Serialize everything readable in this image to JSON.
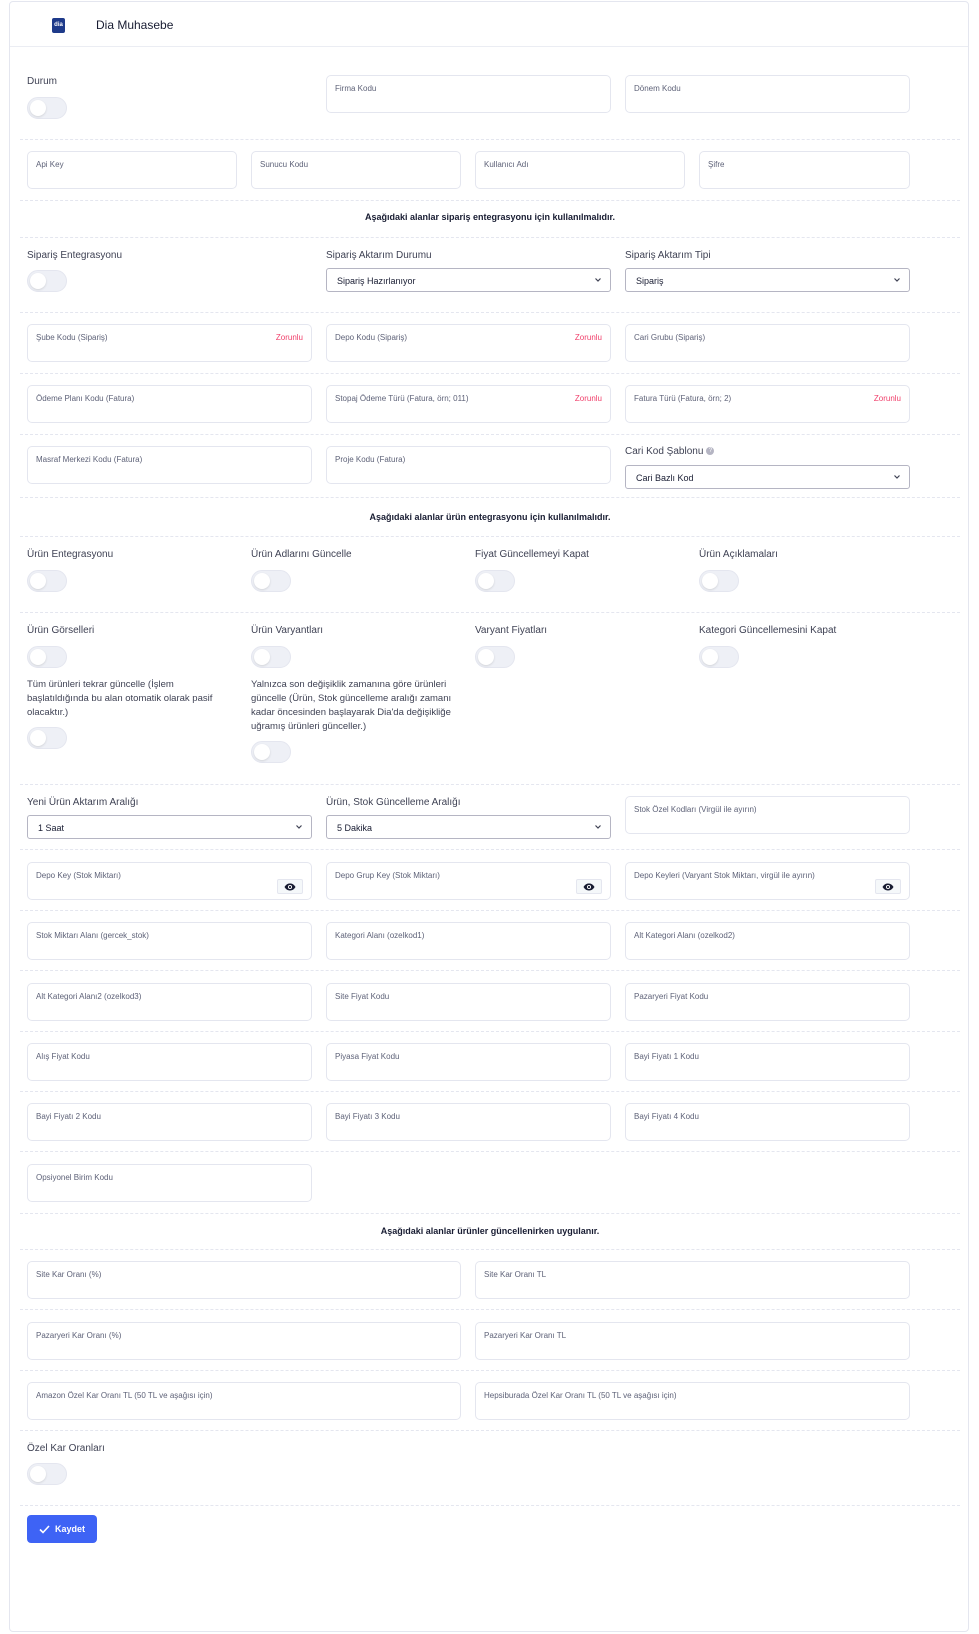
{
  "header": {
    "title": "Dia Muhasebe",
    "logo_text": "dia"
  },
  "general": {
    "durum_label": "Durum",
    "firma_kodu": "Firma Kodu",
    "donem_kodu": "Dönem Kodu",
    "api_key": "Api Key",
    "sunucu_kodu": "Sunucu Kodu",
    "kullanici_adi": "Kullanıcı Adı",
    "sifre": "Şifre"
  },
  "siparis": {
    "section_title": "Aşağıdaki alanlar sipariş entegrasyonu için kullanılmalıdır.",
    "entegrasyon_label": "Sipariş Entegrasyonu",
    "aktarim_durumu_label": "Sipariş Aktarım Durumu",
    "aktarim_durumu_value": "Sipariş Hazırlanıyor",
    "aktarim_tipi_label": "Sipariş Aktarım Tipi",
    "aktarim_tipi_value": "Sipariş",
    "sube_kodu": "Şube Kodu (Sipariş)",
    "depo_kodu": "Depo Kodu (Sipariş)",
    "cari_grubu": "Cari Grubu (Sipariş)",
    "odeme_plani": "Ödeme Planı Kodu (Fatura)",
    "stopaj": "Stopaj Ödeme Türü (Fatura, örn; 011)",
    "fatura_turu": "Fatura Türü (Fatura, örn; 2)",
    "masraf_merkezi": "Masraf Merkezi Kodu (Fatura)",
    "proje_kodu": "Proje Kodu (Fatura)",
    "cari_sablon_label": "Cari Kod Şablonu",
    "cari_sablon_value": "Cari Bazlı Kod",
    "required": "Zorunlu"
  },
  "urun": {
    "section_title": "Aşağıdaki alanlar ürün entegrasyonu için kullanılmalıdır.",
    "toggles": [
      "Ürün Entegrasyonu",
      "Ürün Adlarını Güncelle",
      "Fiyat Güncellemeyi Kapat",
      "Ürün Açıklamaları",
      "Ürün Görselleri",
      "Ürün Varyantları",
      "Varyant Fiyatları",
      "Kategori Güncellemesini Kapat"
    ],
    "tum_urunler_text": "Tüm ürünleri tekrar güncelle (İşlem başlatıldığında bu alan otomatik olarak pasif olacaktır.)",
    "son_degisiklik_text": "Yalnızca son değişiklik zamanına göre ürünleri güncelle (Ürün, Stok güncelleme aralığı zamanı kadar öncesinden başlayarak Dia'da değişikliğe uğramış ürünleri günceller.)",
    "yeni_urun_label": "Yeni Ürün Aktarım Aralığı",
    "yeni_urun_value": "1 Saat",
    "stok_guncelleme_label": "Ürün, Stok Güncelleme Aralığı",
    "stok_guncelleme_value": "5 Dakika",
    "stok_ozel_kodlari": "Stok Özel Kodları (Virgül ile ayırın)",
    "depo_key": "Depo Key (Stok Miktarı)",
    "depo_grup_key": "Depo Grup Key (Stok Miktarı)",
    "depo_keyleri": "Depo Keyleri (Varyant Stok Miktarı, virgül ile ayırın)",
    "stok_miktari_alani": "Stok Miktarı Alanı (gercek_stok)",
    "kategori_alani": "Kategori Alanı (ozelkod1)",
    "alt_kategori_alani": "Alt Kategori Alanı (ozelkod2)",
    "alt_kategori_alani2": "Alt Kategori Alanı2 (ozelkod3)",
    "site_fiyat_kodu": "Site Fiyat Kodu",
    "pazaryeri_fiyat_kodu": "Pazaryeri Fiyat Kodu",
    "alis_fiyat_kodu": "Alış Fiyat Kodu",
    "piyasa_fiyat_kodu": "Piyasa Fiyat Kodu",
    "bayi_fiyati_1": "Bayi Fiyatı 1 Kodu",
    "bayi_fiyati_2": "Bayi Fiyatı 2 Kodu",
    "bayi_fiyati_3": "Bayi Fiyatı 3 Kodu",
    "bayi_fiyati_4": "Bayi Fiyatı 4 Kodu",
    "opsiyonel_birim": "Opsiyonel Birim Kodu"
  },
  "kar": {
    "section_title": "Aşağıdaki alanlar ürünler güncellenirken uygulanır.",
    "site_kar_yuzde": "Site Kar Oranı (%)",
    "site_kar_tl": "Site Kar Oranı TL",
    "pazaryeri_kar_yuzde": "Pazaryeri Kar Oranı (%)",
    "pazaryeri_kar_tl": "Pazaryeri Kar Oranı TL",
    "amazon_ozel": "Amazon Özel Kar Oranı TL (50 TL ve aşağısı için)",
    "hepsiburada_ozel": "Hepsiburada Özel Kar Oranı TL (50 TL ve aşağısı için)",
    "ozel_kar_label": "Özel Kar Oranları"
  },
  "actions": {
    "save_label": "Kaydet"
  },
  "colors": {
    "primary": "#3e63f5",
    "required": "#f1416c",
    "border": "#e4e6ef"
  }
}
